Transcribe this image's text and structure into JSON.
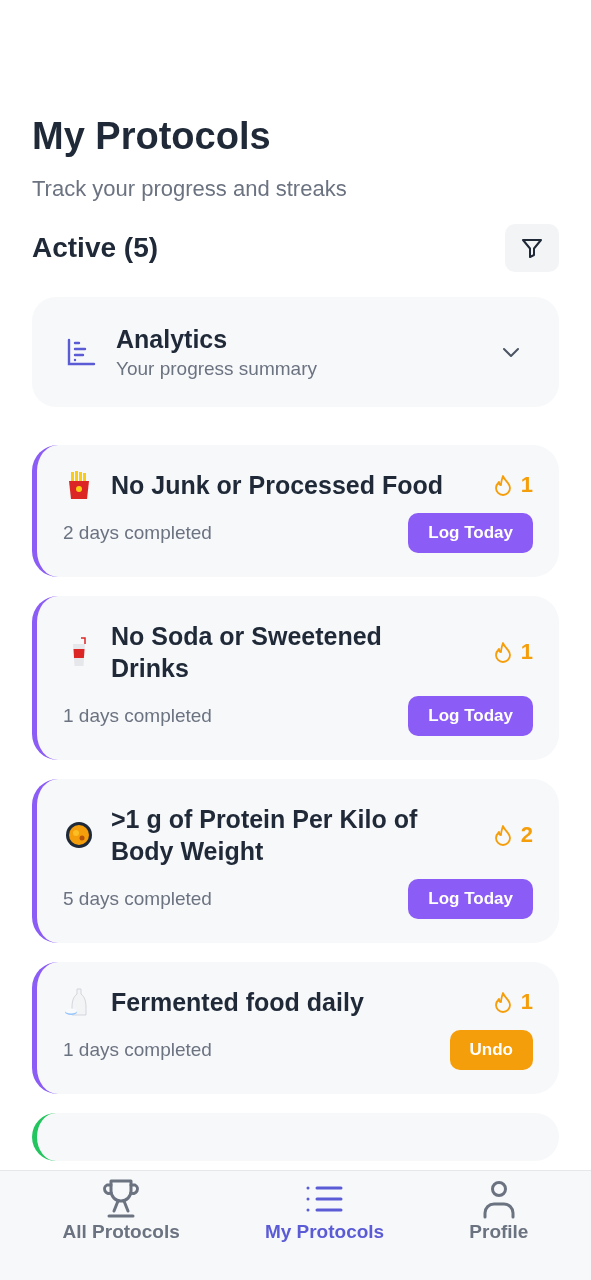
{
  "header": {
    "title": "My Protocols",
    "subtitle": "Track your progress and streaks"
  },
  "section": {
    "title": "Active (5)"
  },
  "analytics": {
    "title": "Analytics",
    "subtitle": "Your progress summary",
    "expanded": false
  },
  "protocols": [
    {
      "kind": "fries",
      "name": "No Junk or Processed Food",
      "streak": "1",
      "progress": "2 days completed",
      "logged": false,
      "action": "Log Today",
      "color": "#8b5cf6"
    },
    {
      "kind": "cup",
      "name": "No Soda or Sweetened Drinks",
      "streak": "1",
      "progress": "1 days completed",
      "logged": false,
      "action": "Log Today",
      "color": "#8b5cf6"
    },
    {
      "kind": "pan",
      "name": ">1 g of Protein Per Kilo of Body Weight",
      "streak": "2",
      "progress": "5 days completed",
      "logged": false,
      "action": "Log Today",
      "color": "#8b5cf6"
    },
    {
      "kind": "bottle",
      "name": "Fermented food daily",
      "streak": "1",
      "progress": "1 days completed",
      "logged": true,
      "action": "Undo",
      "color": "#8b5cf6"
    },
    {
      "color": "#22c55e"
    }
  ],
  "tabs": [
    {
      "label": "All Protocols",
      "selected": false
    },
    {
      "label": "My Protocols",
      "selected": true
    },
    {
      "label": "Profile",
      "selected": false
    }
  ]
}
